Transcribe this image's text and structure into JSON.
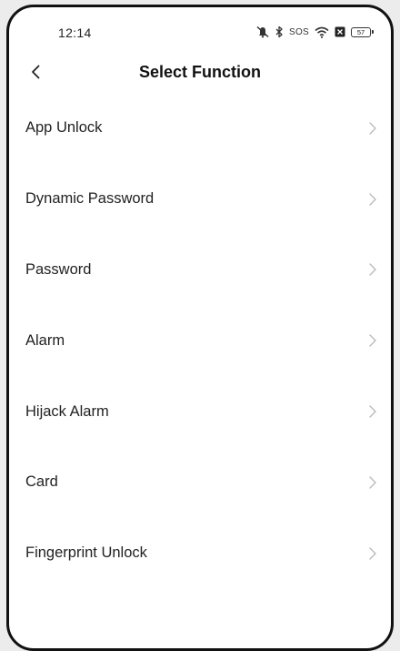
{
  "status_bar": {
    "time": "12:14",
    "sos": "SOS",
    "battery": "57",
    "icons": [
      "mute-icon",
      "bluetooth-icon",
      "wifi-icon",
      "sim-icon"
    ]
  },
  "nav": {
    "back_icon": "chevron-left-icon",
    "title": "Select Function"
  },
  "menu": {
    "items": [
      {
        "label": "App Unlock"
      },
      {
        "label": "Dynamic Password"
      },
      {
        "label": "Password"
      },
      {
        "label": "Alarm"
      },
      {
        "label": "Hijack Alarm"
      },
      {
        "label": "Card"
      },
      {
        "label": "Fingerprint Unlock"
      }
    ]
  },
  "colors": {
    "text": "#222222",
    "chevron": "#b8b8b8",
    "background": "#ffffff",
    "frame": "#111111"
  }
}
